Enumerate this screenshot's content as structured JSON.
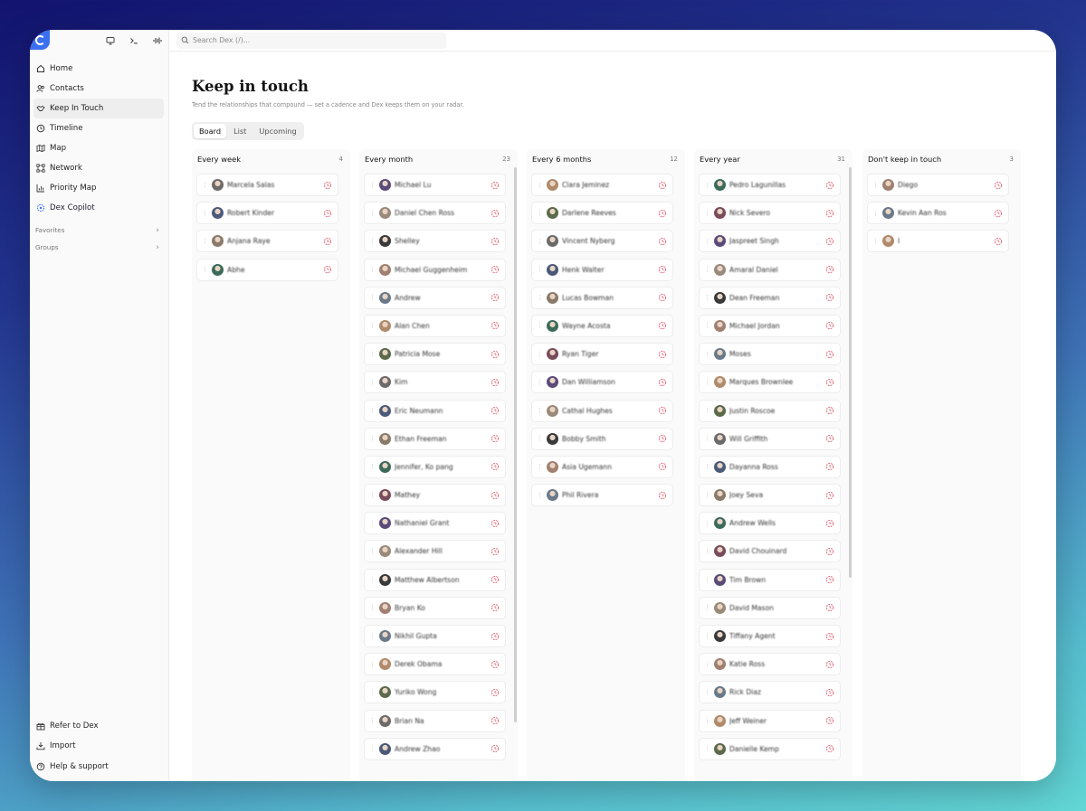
{
  "app": {
    "name": "Dex"
  },
  "search": {
    "placeholder": "Search Dex (/)..."
  },
  "sidebar": {
    "items": [
      {
        "label": "Home",
        "icon": "home-icon"
      },
      {
        "label": "Contacts",
        "icon": "users-icon"
      },
      {
        "label": "Keep In Touch",
        "icon": "handshake-icon"
      },
      {
        "label": "Timeline",
        "icon": "clock-icon"
      },
      {
        "label": "Map",
        "icon": "map-icon"
      },
      {
        "label": "Network",
        "icon": "network-icon"
      },
      {
        "label": "Priority Map",
        "icon": "chart-icon"
      },
      {
        "label": "Dex Copilot",
        "icon": "sparkle-icon"
      }
    ],
    "sections": [
      {
        "label": "Favorites"
      },
      {
        "label": "Groups"
      }
    ],
    "bottom": [
      {
        "label": "Refer to Dex",
        "icon": "gift-icon"
      },
      {
        "label": "Import",
        "icon": "import-icon"
      },
      {
        "label": "Help & support",
        "icon": "help-icon"
      }
    ]
  },
  "page": {
    "title": "Keep in touch",
    "subtitle": "Tend the relationships that compound — set a cadence and Dex keeps them on your radar."
  },
  "tabs": [
    {
      "label": "Board",
      "active": true
    },
    {
      "label": "List",
      "active": false
    },
    {
      "label": "Upcoming",
      "active": false
    }
  ],
  "columns": [
    {
      "title": "Every week",
      "count": "4",
      "cards": [
        "Marcela Salas",
        "Robert Kinder",
        "Anjana Raye",
        "Abhe"
      ]
    },
    {
      "title": "Every month",
      "count": "23",
      "cards": [
        "Michael Lu",
        "Daniel Chen Ross",
        "Shelley",
        "Michael Guggenheim",
        "Andrew",
        "Alan Chen",
        "Patricia Mose",
        "Kim",
        "Eric Neumann",
        "Ethan Freeman",
        "Jennifer, Ko pang",
        "Mathey",
        "Nathaniel Grant",
        "Alexander Hill",
        "Matthew Albertson",
        "Bryan Ko",
        "Nikhil Gupta",
        "Derek Obama",
        "Yuriko Wong",
        "Brian Na",
        "Andrew Zhao"
      ]
    },
    {
      "title": "Every 6 months",
      "count": "12",
      "cards": [
        "Clara Jeminez",
        "Darlene Reeves",
        "Vincent Nyberg",
        "Henk Walter",
        "Lucas Bowman",
        "Wayne Acosta",
        "Ryan Tiger",
        "Dan Williamson",
        "Cathal Hughes",
        "Bobby Smith",
        "Asia Ugemann",
        "Phil Rivera"
      ]
    },
    {
      "title": "Every year",
      "count": "31",
      "cards": [
        "Pedro Lagunillas",
        "Nick Severo",
        "Jaspreet Singh",
        "Amaral Daniel",
        "Dean Freeman",
        "Michael Jordan",
        "Moses",
        "Marques Brownlee",
        "Justin Roscoe",
        "Will Griffith",
        "Dayanna Ross",
        "Joey Seva",
        "Andrew Wells",
        "David Chouinard",
        "Tim Brown",
        "David Mason",
        "Tiffany Agent",
        "Katie Ross",
        "Rick Diaz",
        "Jeff Weiner",
        "Danielle Kemp"
      ]
    },
    {
      "title": "Don't keep in touch",
      "count": "3",
      "cards": [
        "Diego",
        "Kevin Aan Ros",
        "I"
      ]
    }
  ],
  "colors": {
    "accent": "#3a6ff0",
    "cadence_icon": "#e25a6a"
  }
}
